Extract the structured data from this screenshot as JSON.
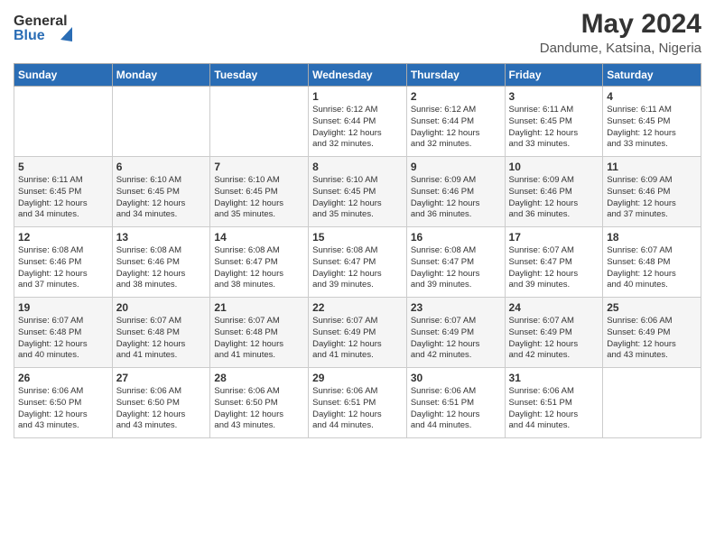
{
  "header": {
    "logo_general": "General",
    "logo_blue": "Blue",
    "month_year": "May 2024",
    "location": "Dandume, Katsina, Nigeria"
  },
  "days_of_week": [
    "Sunday",
    "Monday",
    "Tuesday",
    "Wednesday",
    "Thursday",
    "Friday",
    "Saturday"
  ],
  "weeks": [
    [
      {
        "day": "",
        "info": ""
      },
      {
        "day": "",
        "info": ""
      },
      {
        "day": "",
        "info": ""
      },
      {
        "day": "1",
        "info": "Sunrise: 6:12 AM\nSunset: 6:44 PM\nDaylight: 12 hours\nand 32 minutes."
      },
      {
        "day": "2",
        "info": "Sunrise: 6:12 AM\nSunset: 6:44 PM\nDaylight: 12 hours\nand 32 minutes."
      },
      {
        "day": "3",
        "info": "Sunrise: 6:11 AM\nSunset: 6:45 PM\nDaylight: 12 hours\nand 33 minutes."
      },
      {
        "day": "4",
        "info": "Sunrise: 6:11 AM\nSunset: 6:45 PM\nDaylight: 12 hours\nand 33 minutes."
      }
    ],
    [
      {
        "day": "5",
        "info": "Sunrise: 6:11 AM\nSunset: 6:45 PM\nDaylight: 12 hours\nand 34 minutes."
      },
      {
        "day": "6",
        "info": "Sunrise: 6:10 AM\nSunset: 6:45 PM\nDaylight: 12 hours\nand 34 minutes."
      },
      {
        "day": "7",
        "info": "Sunrise: 6:10 AM\nSunset: 6:45 PM\nDaylight: 12 hours\nand 35 minutes."
      },
      {
        "day": "8",
        "info": "Sunrise: 6:10 AM\nSunset: 6:45 PM\nDaylight: 12 hours\nand 35 minutes."
      },
      {
        "day": "9",
        "info": "Sunrise: 6:09 AM\nSunset: 6:46 PM\nDaylight: 12 hours\nand 36 minutes."
      },
      {
        "day": "10",
        "info": "Sunrise: 6:09 AM\nSunset: 6:46 PM\nDaylight: 12 hours\nand 36 minutes."
      },
      {
        "day": "11",
        "info": "Sunrise: 6:09 AM\nSunset: 6:46 PM\nDaylight: 12 hours\nand 37 minutes."
      }
    ],
    [
      {
        "day": "12",
        "info": "Sunrise: 6:08 AM\nSunset: 6:46 PM\nDaylight: 12 hours\nand 37 minutes."
      },
      {
        "day": "13",
        "info": "Sunrise: 6:08 AM\nSunset: 6:46 PM\nDaylight: 12 hours\nand 38 minutes."
      },
      {
        "day": "14",
        "info": "Sunrise: 6:08 AM\nSunset: 6:47 PM\nDaylight: 12 hours\nand 38 minutes."
      },
      {
        "day": "15",
        "info": "Sunrise: 6:08 AM\nSunset: 6:47 PM\nDaylight: 12 hours\nand 39 minutes."
      },
      {
        "day": "16",
        "info": "Sunrise: 6:08 AM\nSunset: 6:47 PM\nDaylight: 12 hours\nand 39 minutes."
      },
      {
        "day": "17",
        "info": "Sunrise: 6:07 AM\nSunset: 6:47 PM\nDaylight: 12 hours\nand 39 minutes."
      },
      {
        "day": "18",
        "info": "Sunrise: 6:07 AM\nSunset: 6:48 PM\nDaylight: 12 hours\nand 40 minutes."
      }
    ],
    [
      {
        "day": "19",
        "info": "Sunrise: 6:07 AM\nSunset: 6:48 PM\nDaylight: 12 hours\nand 40 minutes."
      },
      {
        "day": "20",
        "info": "Sunrise: 6:07 AM\nSunset: 6:48 PM\nDaylight: 12 hours\nand 41 minutes."
      },
      {
        "day": "21",
        "info": "Sunrise: 6:07 AM\nSunset: 6:48 PM\nDaylight: 12 hours\nand 41 minutes."
      },
      {
        "day": "22",
        "info": "Sunrise: 6:07 AM\nSunset: 6:49 PM\nDaylight: 12 hours\nand 41 minutes."
      },
      {
        "day": "23",
        "info": "Sunrise: 6:07 AM\nSunset: 6:49 PM\nDaylight: 12 hours\nand 42 minutes."
      },
      {
        "day": "24",
        "info": "Sunrise: 6:07 AM\nSunset: 6:49 PM\nDaylight: 12 hours\nand 42 minutes."
      },
      {
        "day": "25",
        "info": "Sunrise: 6:06 AM\nSunset: 6:49 PM\nDaylight: 12 hours\nand 43 minutes."
      }
    ],
    [
      {
        "day": "26",
        "info": "Sunrise: 6:06 AM\nSunset: 6:50 PM\nDaylight: 12 hours\nand 43 minutes."
      },
      {
        "day": "27",
        "info": "Sunrise: 6:06 AM\nSunset: 6:50 PM\nDaylight: 12 hours\nand 43 minutes."
      },
      {
        "day": "28",
        "info": "Sunrise: 6:06 AM\nSunset: 6:50 PM\nDaylight: 12 hours\nand 43 minutes."
      },
      {
        "day": "29",
        "info": "Sunrise: 6:06 AM\nSunset: 6:51 PM\nDaylight: 12 hours\nand 44 minutes."
      },
      {
        "day": "30",
        "info": "Sunrise: 6:06 AM\nSunset: 6:51 PM\nDaylight: 12 hours\nand 44 minutes."
      },
      {
        "day": "31",
        "info": "Sunrise: 6:06 AM\nSunset: 6:51 PM\nDaylight: 12 hours\nand 44 minutes."
      },
      {
        "day": "",
        "info": ""
      }
    ]
  ]
}
